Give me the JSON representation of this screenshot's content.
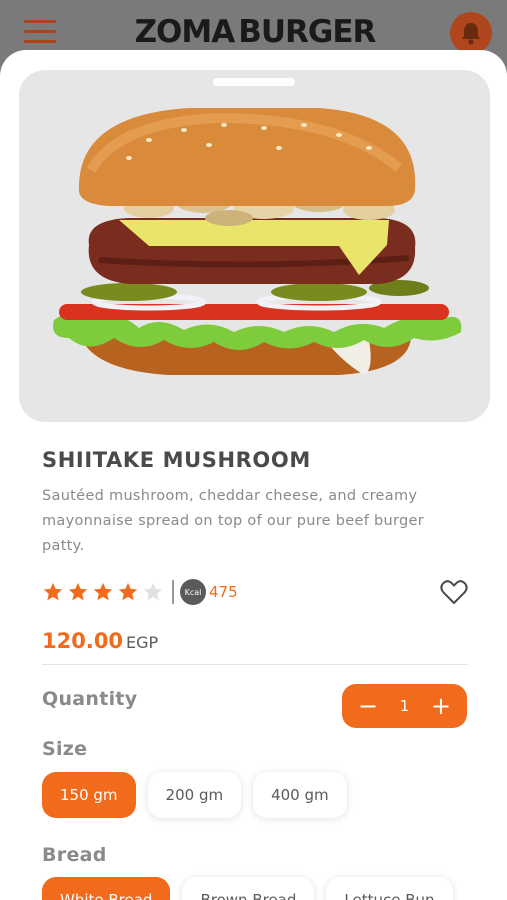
{
  "header": {
    "logo_left": "ZOMA",
    "logo_right": "BURGER"
  },
  "product": {
    "name": "SHIITAKE MUSHROOM",
    "description": "Sautéed mushroom, cheddar cheese, and creamy mayonnaise spread on top of our pure beef burger patty.",
    "rating": 4,
    "rating_max": 5,
    "kcal_label": "Kcal",
    "kcal_value": "475",
    "price": "120.00",
    "currency": "EGP"
  },
  "quantity": {
    "label": "Quantity",
    "value": "1",
    "minus": "−",
    "plus": "+"
  },
  "size": {
    "label": "Size",
    "options": [
      "150 gm",
      "200 gm",
      "400 gm"
    ],
    "selected": "150 gm"
  },
  "bread": {
    "label": "Bread",
    "options": [
      "White Bread",
      "Brown Bread",
      "Lettuce Bun"
    ],
    "selected": "White Bread"
  },
  "colors": {
    "accent": "#f26a1b",
    "text_dark": "#4a4a4a",
    "text_muted": "#8a8a8a"
  }
}
